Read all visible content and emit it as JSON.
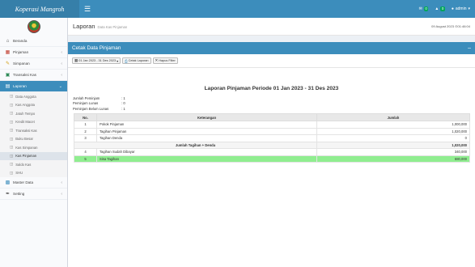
{
  "header": {
    "brand": "Koperasi Mangroh",
    "toggle_icon": "hamburger-icon",
    "notif_count": "0",
    "alert_count": "0",
    "user_label": "admin"
  },
  "sidebar": {
    "items": [
      {
        "label": "Beranda",
        "icon": "home-icon"
      },
      {
        "label": "Pinjaman",
        "icon": "chart-icon"
      },
      {
        "label": "Simpanan",
        "icon": "pencil-icon"
      },
      {
        "label": "Transaksi Kas",
        "icon": "money-icon"
      },
      {
        "label": "Laporan",
        "icon": "report-icon"
      },
      {
        "label": "Master Data",
        "icon": "database-icon"
      },
      {
        "label": "Setting",
        "icon": "wrench-icon"
      }
    ],
    "submenu": [
      "Data Anggota",
      "Kas Anggota",
      "Jatuh Tempo",
      "Kredit Macet",
      "Transaksi Kas",
      "Buku Besar",
      "Kas Simpanan",
      "Kas Pinjaman",
      "Saldo Kas",
      "SHU"
    ]
  },
  "content": {
    "title": "Laporan",
    "subtitle": "Data Kas Pinjaman",
    "date_stamp": "09 August 2023 ⊙01:46:04"
  },
  "box": {
    "title": "Cetak Data Pinjaman",
    "collapse_icon": "minus-icon"
  },
  "toolbar": {
    "date_range": "01 Jan 2023 - 31 Des 2023",
    "print_label": "Cetak Laporan",
    "clear_label": "Hapus Filter"
  },
  "report": {
    "title": "Laporan Pinjaman Periode 01 Jan 2023 - 31 Des 2023",
    "summary": [
      {
        "label": "Jumlah Peminjam",
        "value": ": 1"
      },
      {
        "label": "Peminjam Lunas",
        "value": ": 0"
      },
      {
        "label": "Peminjam Belum Lunas",
        "value": ": 1"
      }
    ],
    "columns": [
      "No.",
      "Keterangan",
      "Jumlah"
    ],
    "rows": [
      {
        "no": "1",
        "ket": "Pokok Pinjaman",
        "amt": "1,000,000"
      },
      {
        "no": "2",
        "ket": "Tagihan Pinjaman",
        "amt": "1,020,000"
      },
      {
        "no": "3",
        "ket": "Tagihan Denda",
        "amt": "0"
      }
    ],
    "subtotal": {
      "label": "Jumlah Tagihan + Denda",
      "amt": "1,020,000"
    },
    "rows2": [
      {
        "no": "4",
        "ket": "Tagihan Sudah Dibayar",
        "amt": "340,000"
      },
      {
        "no": "5",
        "ket": "Sisa Tagihan",
        "amt": "680,000"
      }
    ]
  }
}
